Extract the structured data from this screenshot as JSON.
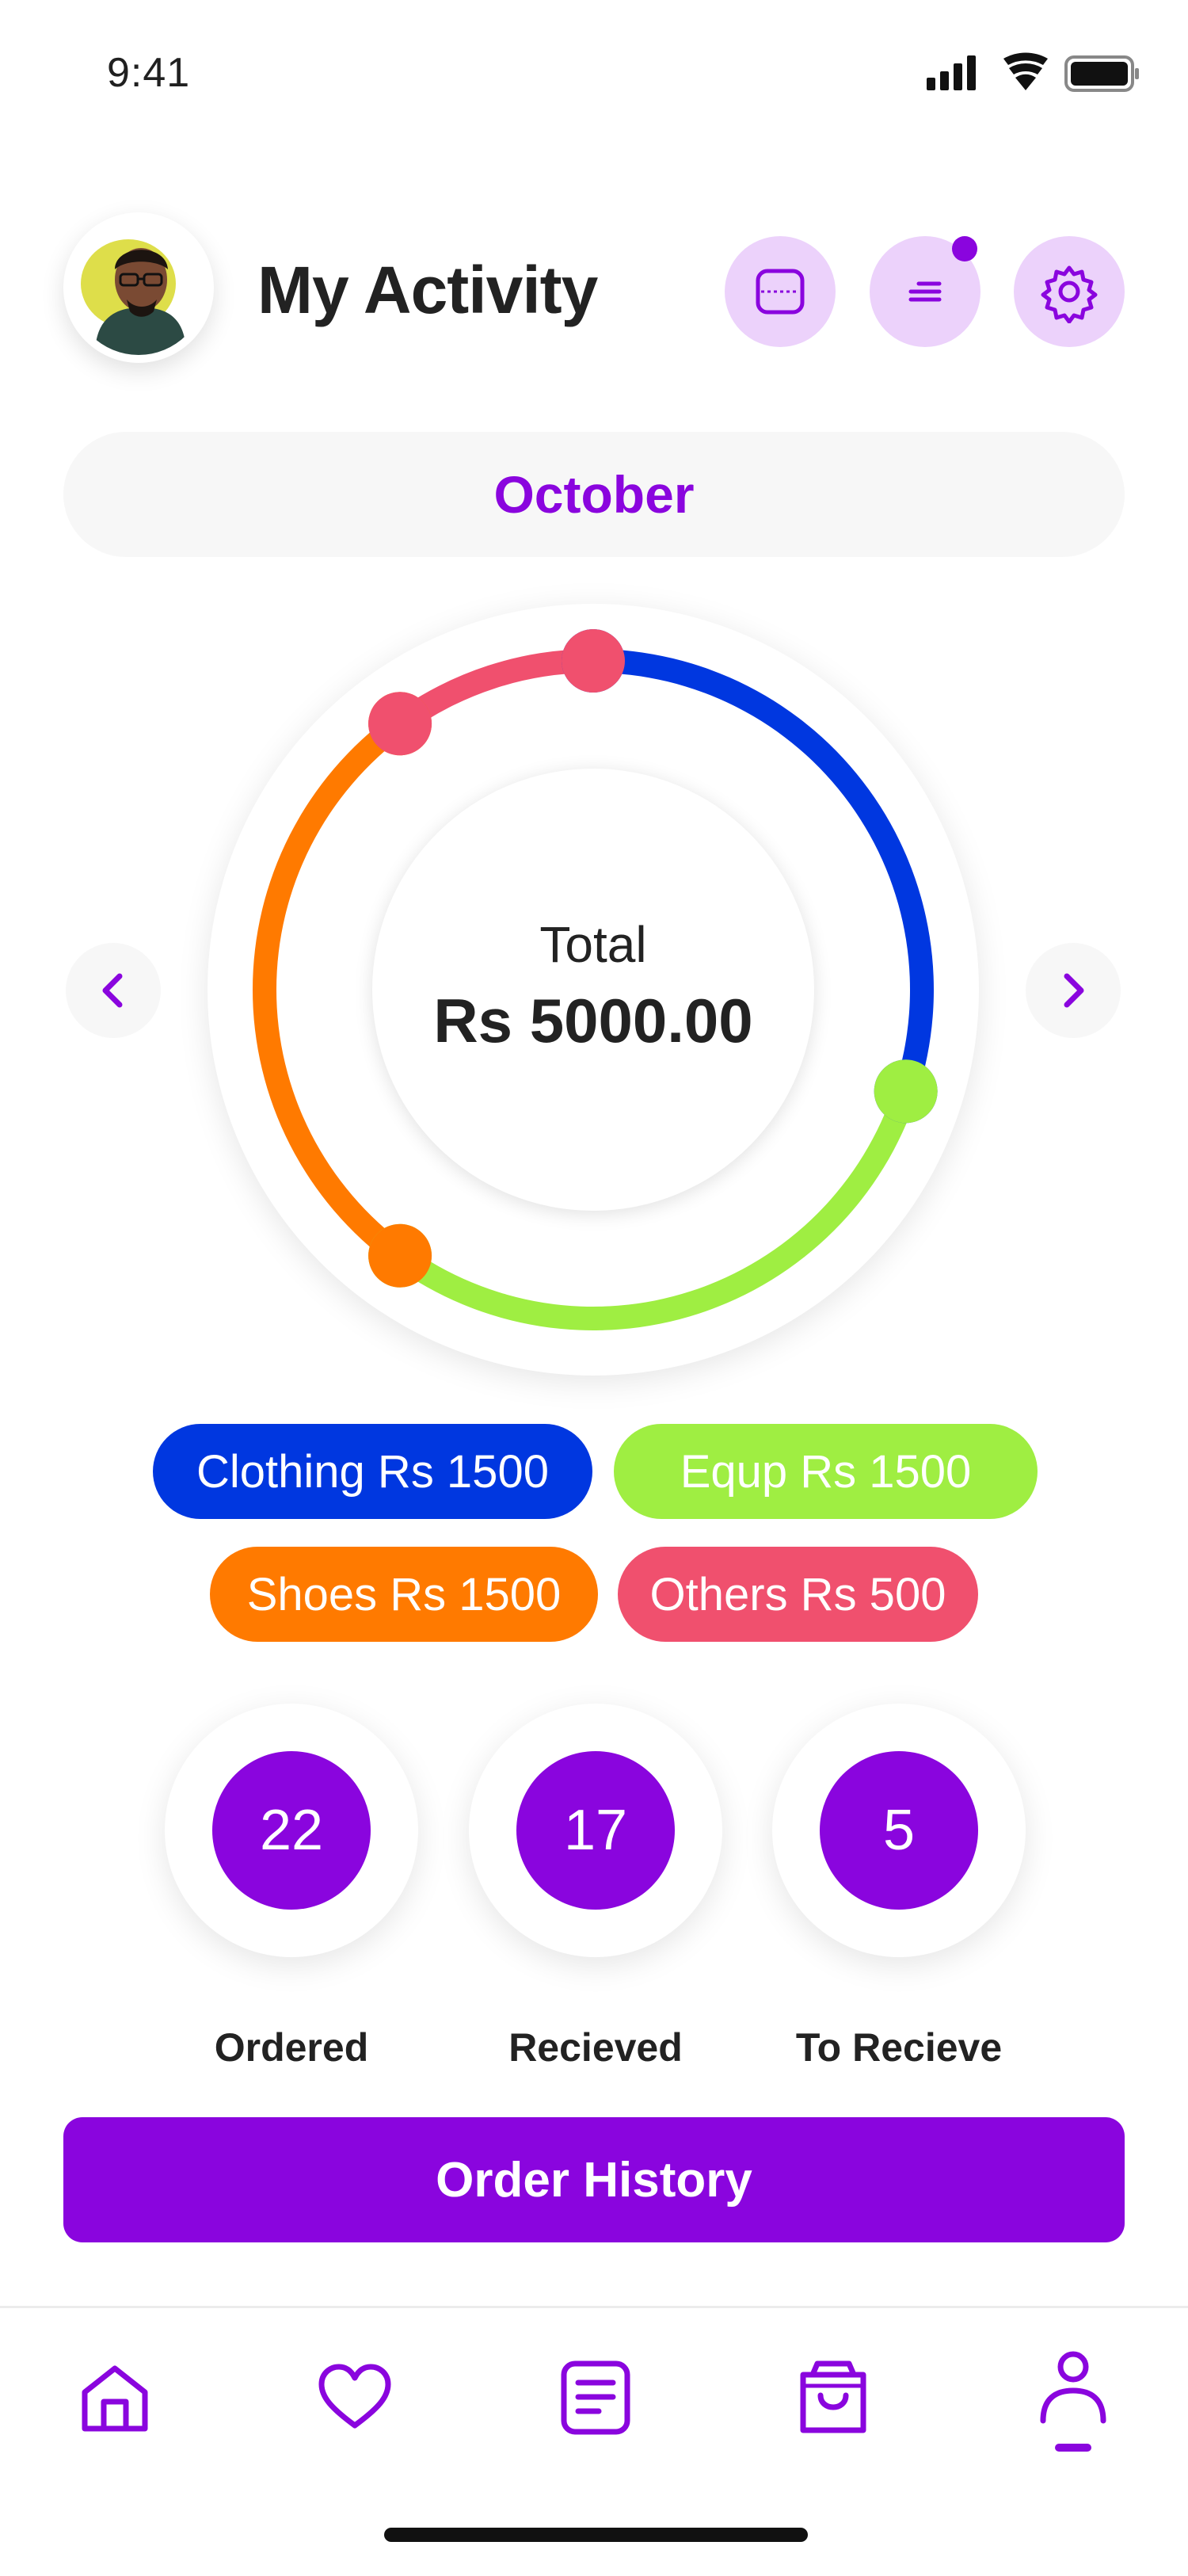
{
  "status_bar": {
    "time": "9:41"
  },
  "header": {
    "title": "My Activity",
    "actions": [
      {
        "name": "scan-button",
        "icon": "scan-icon"
      },
      {
        "name": "filter-button",
        "icon": "menu-lines-icon",
        "has_notification": true
      },
      {
        "name": "settings-button",
        "icon": "gear-icon"
      }
    ]
  },
  "month": {
    "label": "October"
  },
  "chart": {
    "prev_icon": "chevron-left-icon",
    "next_icon": "chevron-right-icon",
    "total_label": "Total",
    "total_value": "Rs 5000.00"
  },
  "chart_data": {
    "type": "pie",
    "categories": [
      "Clothing",
      "Equp",
      "Shoes",
      "Others"
    ],
    "values": [
      1500,
      1500,
      1500,
      500
    ],
    "colors": [
      "#0037e0",
      "#9fee42",
      "#ff7a00",
      "#f0506e"
    ],
    "total": 5000,
    "legend_placement": "bottom"
  },
  "legend": {
    "items": [
      {
        "label": "Clothing Rs 1500",
        "color": "#0037e0"
      },
      {
        "label": "Equp Rs 1500",
        "color": "#9fee42"
      },
      {
        "label": "Shoes Rs 1500",
        "color": "#ff7a00"
      },
      {
        "label": "Others Rs 500",
        "color": "#f0506e"
      }
    ]
  },
  "stats": [
    {
      "value": "22",
      "label": "Ordered"
    },
    {
      "value": "17",
      "label": "Recieved"
    },
    {
      "value": "5",
      "label": "To Recieve"
    }
  ],
  "order_history": {
    "label": "Order History"
  },
  "tabbar": {
    "items": [
      {
        "name": "home",
        "icon": "home-icon"
      },
      {
        "name": "wishlist",
        "icon": "heart-icon"
      },
      {
        "name": "orders",
        "icon": "list-document-icon"
      },
      {
        "name": "cart",
        "icon": "shopping-bag-icon"
      },
      {
        "name": "profile",
        "icon": "user-icon",
        "active": true
      }
    ]
  },
  "colors": {
    "accent": "#8a05de",
    "accent_light": "#ecd2fb"
  }
}
